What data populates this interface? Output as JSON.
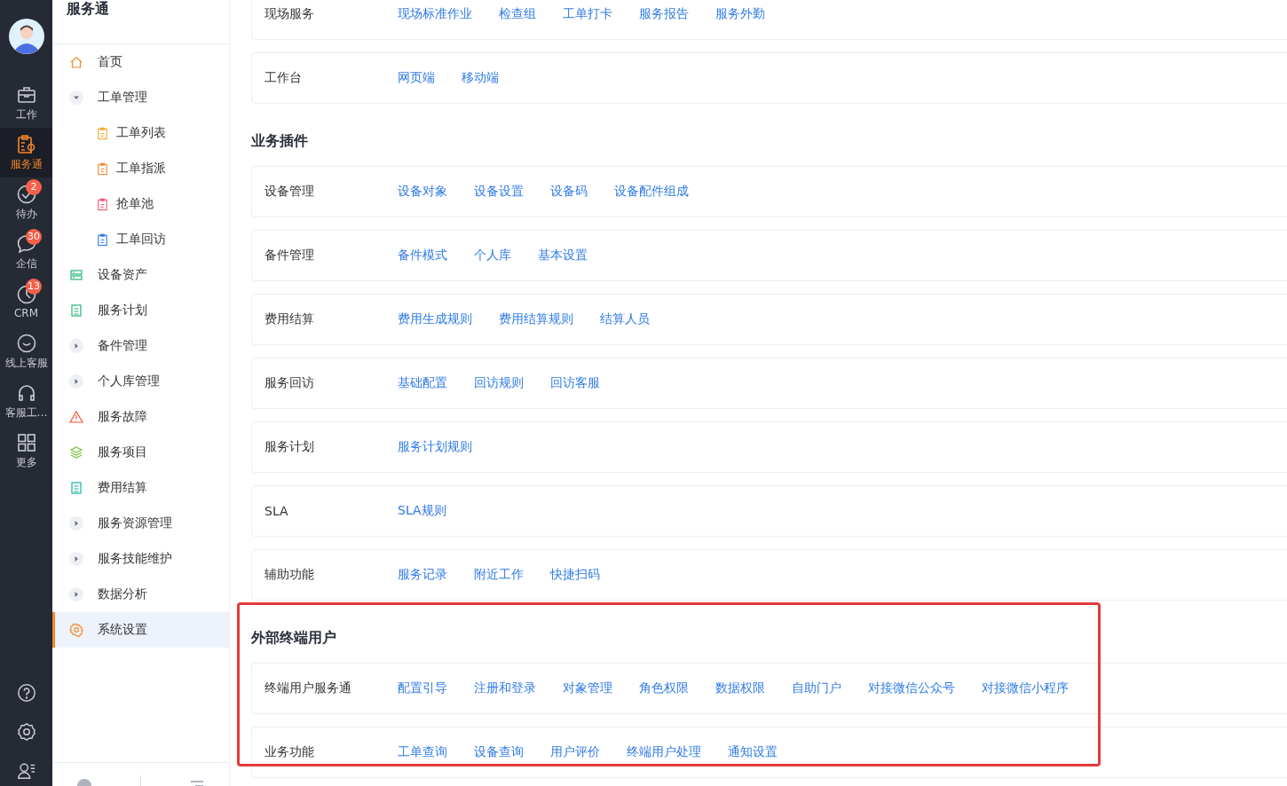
{
  "rail": {
    "items": [
      {
        "label": "工作",
        "selected": false
      },
      {
        "label": "服务通",
        "selected": true
      },
      {
        "label": "待办",
        "selected": false,
        "badge": "2"
      },
      {
        "label": "企信",
        "selected": false,
        "badge": "30"
      },
      {
        "label": "CRM",
        "selected": false,
        "badge": "13"
      },
      {
        "label": "线上客服",
        "selected": false
      },
      {
        "label": "客服工…",
        "selected": false
      },
      {
        "label": "更多",
        "selected": false
      }
    ]
  },
  "nav": {
    "title": "服务通",
    "items": [
      {
        "kind": "page",
        "label": "首页",
        "selected": false
      },
      {
        "kind": "group",
        "label": "工单管理",
        "expanded": true,
        "children": [
          {
            "label": "工单列表",
            "selected": false
          },
          {
            "label": "工单指派",
            "selected": false
          },
          {
            "label": "抢单池",
            "selected": false
          },
          {
            "label": "工单回访",
            "selected": false
          }
        ]
      },
      {
        "kind": "page",
        "label": "设备资产",
        "selected": false
      },
      {
        "kind": "page",
        "label": "服务计划",
        "selected": false
      },
      {
        "kind": "group",
        "label": "备件管理",
        "expanded": false
      },
      {
        "kind": "group",
        "label": "个人库管理",
        "expanded": false
      },
      {
        "kind": "page",
        "label": "服务故障",
        "selected": false
      },
      {
        "kind": "page",
        "label": "服务项目",
        "selected": false
      },
      {
        "kind": "page",
        "label": "费用结算",
        "selected": false
      },
      {
        "kind": "group",
        "label": "服务资源管理",
        "expanded": false
      },
      {
        "kind": "group",
        "label": "服务技能维护",
        "expanded": false
      },
      {
        "kind": "group",
        "label": "数据分析",
        "expanded": false
      },
      {
        "kind": "page",
        "label": "系统设置",
        "selected": true
      }
    ]
  },
  "sections": [
    {
      "highlighted": false,
      "groups": [
        {
          "label": "现场服务",
          "links": [
            "现场标准作业",
            "检查组",
            "工单打卡",
            "服务报告",
            "服务外勤"
          ]
        },
        {
          "label": "工作台",
          "links": [
            "网页端",
            "移动端"
          ]
        }
      ]
    },
    {
      "title": "业务插件",
      "highlighted": false,
      "groups": [
        {
          "label": "设备管理",
          "links": [
            "设备对象",
            "设备设置",
            "设备码",
            "设备配件组成"
          ]
        },
        {
          "label": "备件管理",
          "links": [
            "备件模式",
            "个人库",
            "基本设置"
          ]
        },
        {
          "label": "费用结算",
          "links": [
            "费用生成规则",
            "费用结算规则",
            "结算人员"
          ]
        },
        {
          "label": "服务回访",
          "links": [
            "基础配置",
            "回访规则",
            "回访客服"
          ]
        },
        {
          "label": "服务计划",
          "links": [
            "服务计划规则"
          ]
        },
        {
          "label": "SLA",
          "links": [
            "SLA规则"
          ]
        },
        {
          "label": "辅助功能",
          "links": [
            "服务记录",
            "附近工作",
            "快捷扫码"
          ]
        }
      ]
    },
    {
      "title": "外部终端用户",
      "highlighted": true,
      "groups": [
        {
          "label": "终端用户服务通",
          "links": [
            "配置引导",
            "注册和登录",
            "对象管理",
            "角色权限",
            "数据权限",
            "自助门户",
            "对接微信公众号",
            "对接微信小程序"
          ]
        },
        {
          "label": "业务功能",
          "links": [
            "工单查询",
            "设备查询",
            "用户评价",
            "终端用户处理",
            "通知设置"
          ]
        }
      ]
    }
  ]
}
